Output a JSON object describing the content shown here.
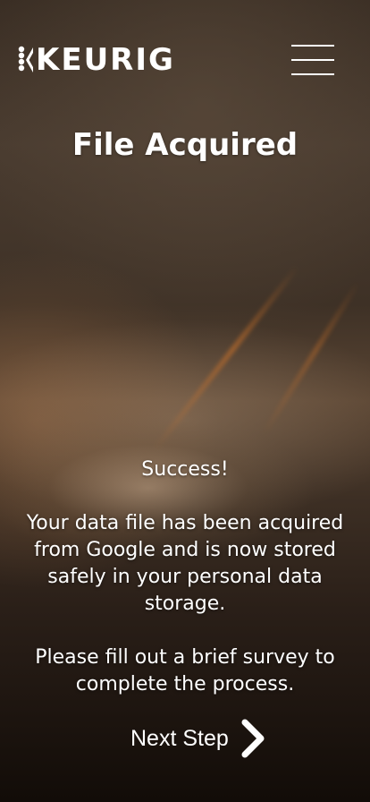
{
  "brand": {
    "logo_text": "KEURIG",
    "logo_icon": "keurig-k-mark"
  },
  "header": {
    "menu_icon": "hamburger-menu-icon"
  },
  "page": {
    "title": "File Acquired"
  },
  "message": {
    "success": "Success!",
    "body": "Your data file has been acquired from Google and is now stored safely in your personal data storage.",
    "survey": "Please fill out a brief survey to complete the process."
  },
  "next_step": {
    "label": "Next Step",
    "icon": "chevron-right-icon"
  },
  "colors": {
    "text": "#ffffff",
    "background": "#2a1f18"
  }
}
